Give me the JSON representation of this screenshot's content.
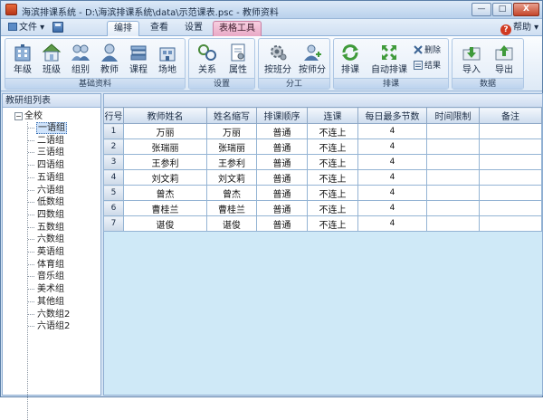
{
  "window": {
    "title": "海滨排课系统 - D:\\海滨排课系统\\data\\示范课表.psc - 教师资料",
    "minimize_label": "—",
    "maximize_label": "□",
    "close_label": "X"
  },
  "menu": {
    "file_label": "文件",
    "tabs": [
      {
        "label": "编排"
      },
      {
        "label": "查看"
      },
      {
        "label": "设置"
      },
      {
        "label": "表格工具"
      }
    ],
    "help_label": "帮助"
  },
  "ribbon": {
    "groups": [
      {
        "label": "基础资料",
        "buttons": [
          {
            "label": "年级",
            "icon": "building-icon"
          },
          {
            "label": "班级",
            "icon": "house-icon"
          },
          {
            "label": "组别",
            "icon": "group-icon"
          },
          {
            "label": "教师",
            "icon": "teacher-icon"
          },
          {
            "label": "课程",
            "icon": "books-icon"
          },
          {
            "label": "场地",
            "icon": "site-icon"
          }
        ]
      },
      {
        "label": "设置",
        "buttons": [
          {
            "label": "关系",
            "icon": "link-icon"
          },
          {
            "label": "属性",
            "icon": "property-icon"
          }
        ]
      },
      {
        "label": "分工",
        "buttons": [
          {
            "label": "按班分",
            "icon": "gear-class-icon"
          },
          {
            "label": "按师分",
            "icon": "add-person-icon"
          }
        ]
      },
      {
        "label": "排课",
        "buttons": [
          {
            "label": "排课",
            "icon": "refresh-icon"
          },
          {
            "label": "自动排课",
            "icon": "auto-arrange-icon"
          }
        ],
        "small_buttons": [
          {
            "label": "删除",
            "icon": "delete-icon"
          },
          {
            "label": "结果",
            "icon": "result-icon"
          }
        ]
      },
      {
        "label": "数据",
        "buttons": [
          {
            "label": "导入",
            "icon": "import-icon"
          },
          {
            "label": "导出",
            "icon": "export-icon"
          }
        ]
      }
    ]
  },
  "left_panel": {
    "title": "教研组列表",
    "root_label": "全校",
    "items": [
      "一语组",
      "二语组",
      "三语组",
      "四语组",
      "五语组",
      "六语组",
      "低数组",
      "四数组",
      "五数组",
      "六数组",
      "英语组",
      "体育组",
      "音乐组",
      "美术组",
      "其他组",
      "六数组2",
      "六语组2"
    ],
    "selected_index": 0
  },
  "grid": {
    "columns": [
      "行号",
      "教师姓名",
      "姓名缩写",
      "排课顺序",
      "连课",
      "每日最多节数",
      "时间限制",
      "备注"
    ],
    "rows": [
      {
        "no": "1",
        "name": "万丽",
        "abbr": "万丽",
        "order": "普通",
        "link": "不连上",
        "max": "4",
        "time": "",
        "note": ""
      },
      {
        "no": "2",
        "name": "张瑞丽",
        "abbr": "张瑞丽",
        "order": "普通",
        "link": "不连上",
        "max": "4",
        "time": "",
        "note": ""
      },
      {
        "no": "3",
        "name": "王参利",
        "abbr": "王参利",
        "order": "普通",
        "link": "不连上",
        "max": "4",
        "time": "",
        "note": ""
      },
      {
        "no": "4",
        "name": "刘文莉",
        "abbr": "刘文莉",
        "order": "普通",
        "link": "不连上",
        "max": "4",
        "time": "",
        "note": ""
      },
      {
        "no": "5",
        "name": "曾杰",
        "abbr": "曾杰",
        "order": "普通",
        "link": "不连上",
        "max": "4",
        "time": "",
        "note": ""
      },
      {
        "no": "6",
        "name": "曹桂兰",
        "abbr": "曹桂兰",
        "order": "普通",
        "link": "不连上",
        "max": "4",
        "time": "",
        "note": ""
      },
      {
        "no": "7",
        "name": "谌俊",
        "abbr": "谌俊",
        "order": "普通",
        "link": "不连上",
        "max": "4",
        "time": "",
        "note": ""
      }
    ]
  }
}
